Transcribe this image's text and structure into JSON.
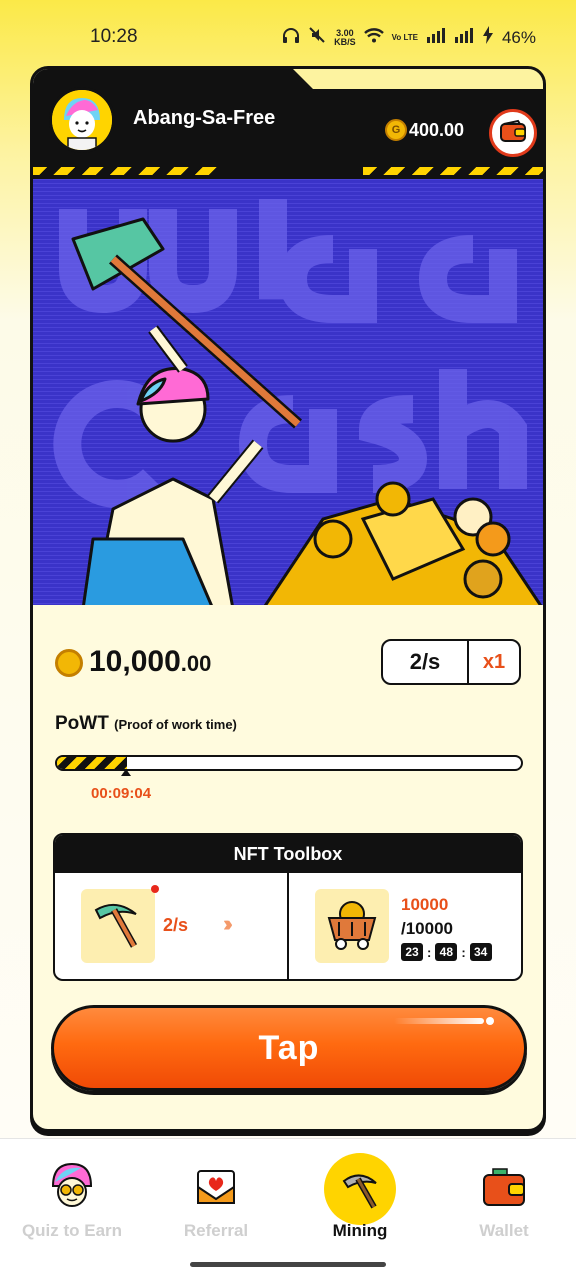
{
  "status_bar": {
    "time": "10:28",
    "network_speed": "3.00",
    "speed_unit": "KB/S",
    "volte": "Vo LTE",
    "battery": "46%"
  },
  "header": {
    "username": "Abang-Sa-Free",
    "balance": "400.00"
  },
  "mining": {
    "mined_whole": "10,000",
    "mined_decimal": ".00",
    "rate": "2/s",
    "multiplier": "x1",
    "powt_title": "PoWT",
    "powt_subtitle": "(Proof of work time)",
    "progress_fraction": 0.15,
    "elapsed": "00:09:04"
  },
  "toolbox": {
    "title": "NFT Toolbox",
    "tool_rate": "2/s",
    "arrows": "›››",
    "capacity_current": "10000",
    "capacity_max": "/10000",
    "countdown": {
      "hours": "23",
      "minutes": "48",
      "seconds": "34"
    }
  },
  "tap_label": "Tap",
  "nav": [
    {
      "label": "Quiz to Earn",
      "icon": "quiz-avatar-icon",
      "active": false
    },
    {
      "label": "Referral",
      "icon": "envelope-heart-icon",
      "active": false
    },
    {
      "label": "Mining",
      "icon": "pickaxe-icon",
      "active": true
    },
    {
      "label": "Wallet",
      "icon": "wallet-icon",
      "active": false
    }
  ],
  "colors": {
    "accent_orange": "#ff6a10",
    "brand_yellow": "#ffd400",
    "hero_blue": "#3a33c8",
    "card_bg": "#fffbde"
  }
}
